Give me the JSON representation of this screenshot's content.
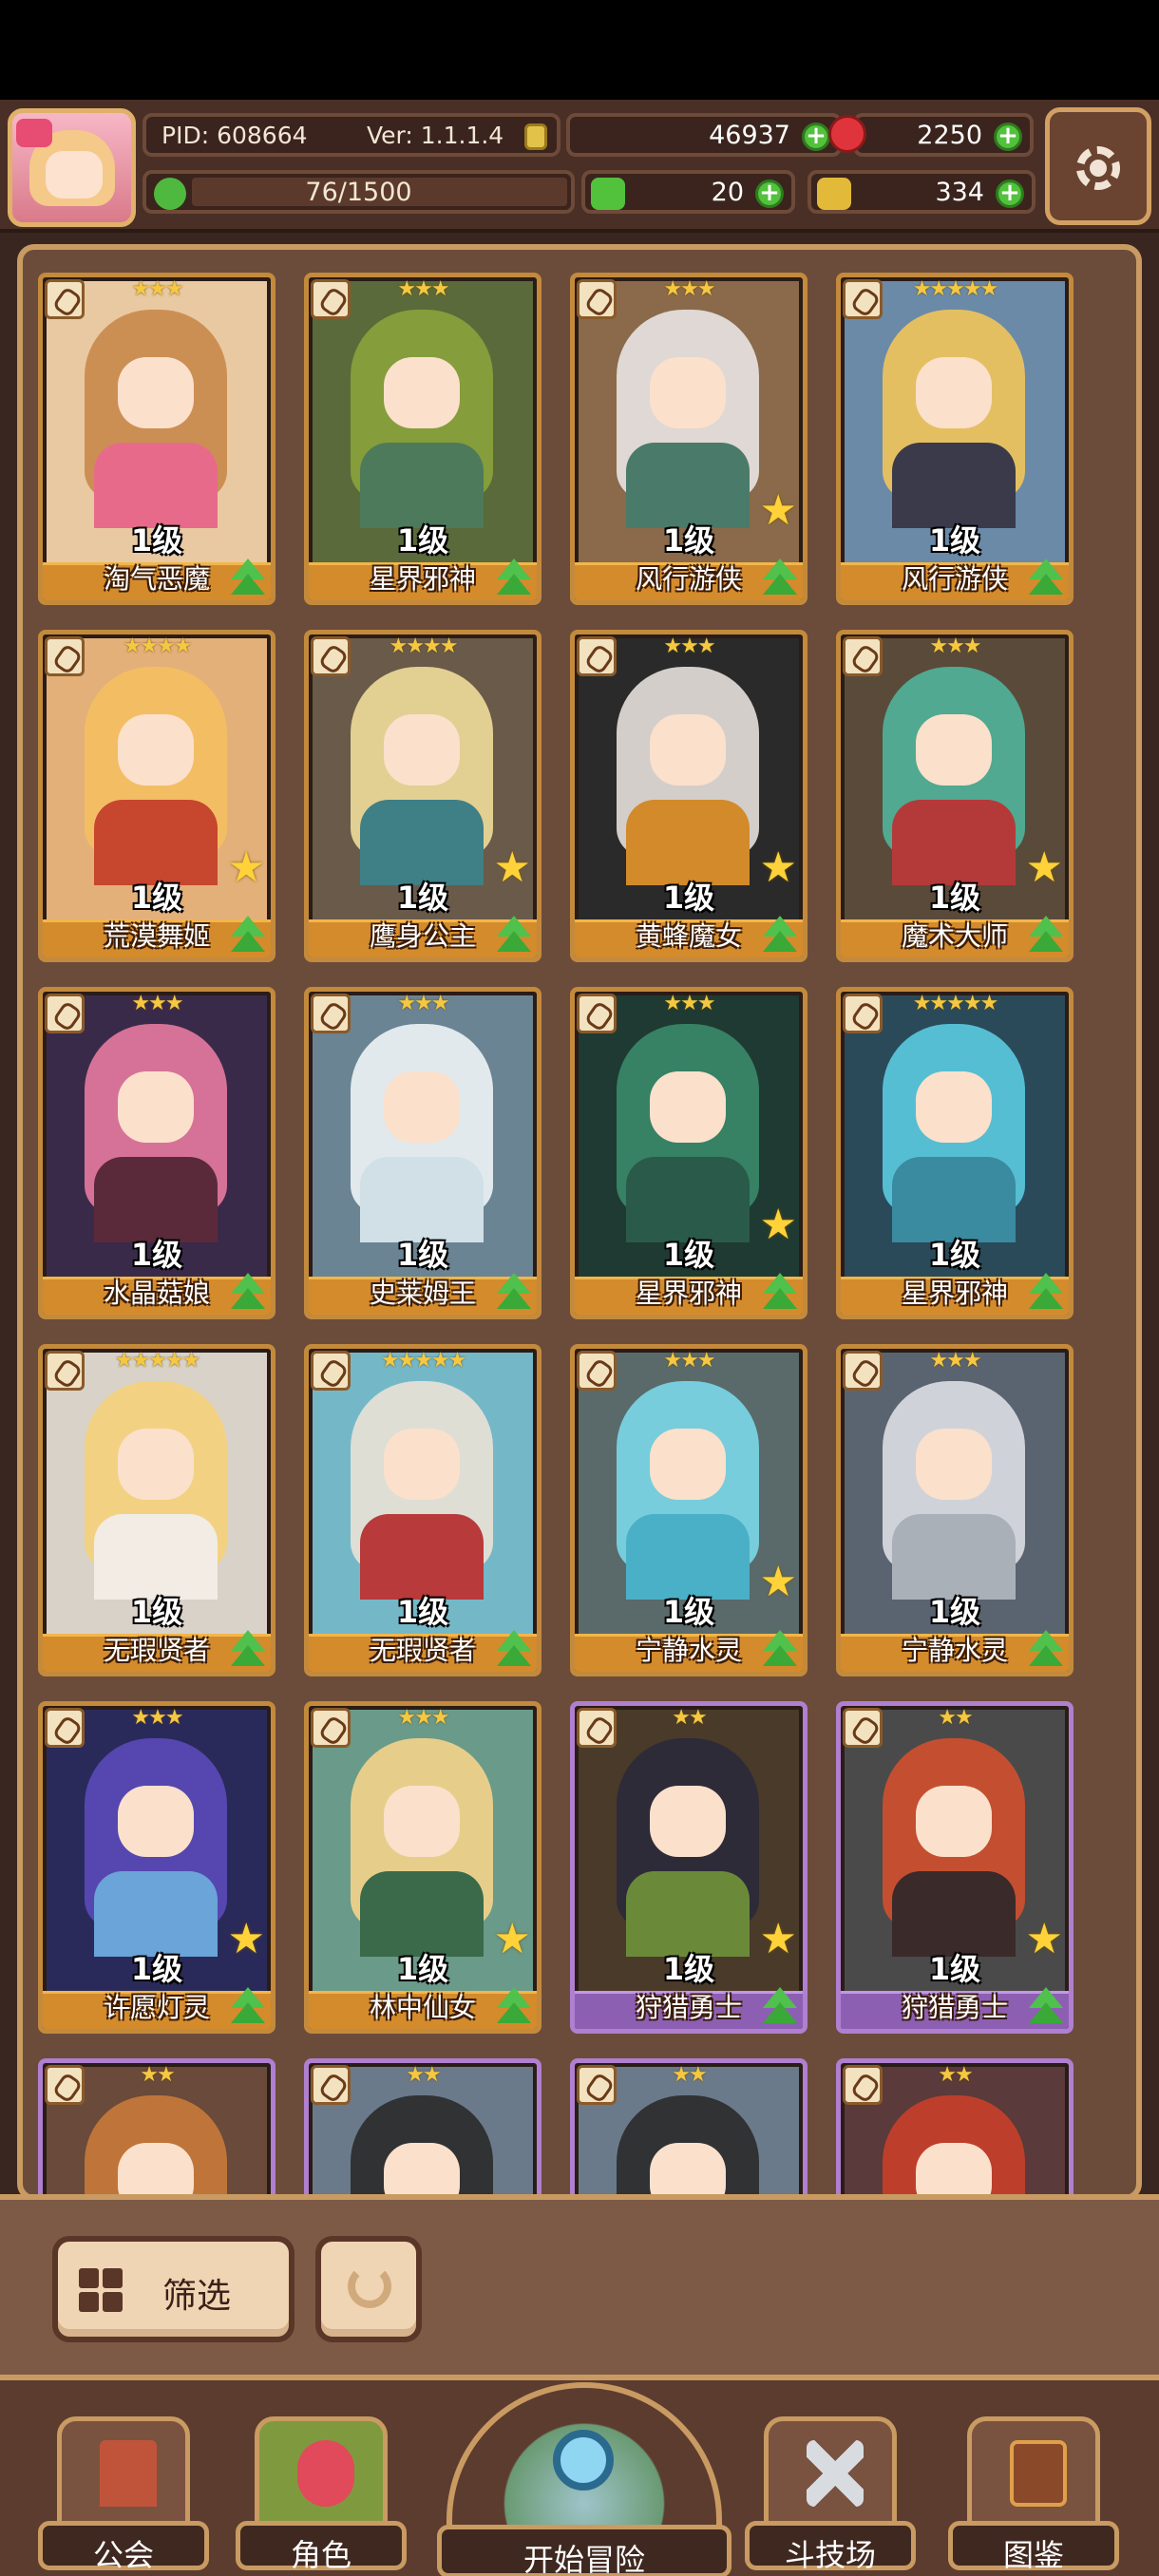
{
  "header": {
    "pid_label": "PID: 608664",
    "version_label": "Ver: 1.1.1.4",
    "gold": "46937",
    "gems": "2250",
    "energy": "76/1500",
    "clovers": "20",
    "keys": "334"
  },
  "heroes": [
    {
      "level": "1级",
      "name": "淘气恶魔",
      "stars": "★★★",
      "frame": "gold",
      "hair": "#c9884a",
      "body": "#e86a8a",
      "bg": "#e9c9a2",
      "gold_star": false
    },
    {
      "level": "1级",
      "name": "星界邪神",
      "stars": "★★★",
      "frame": "gold",
      "hair": "#8aa33c",
      "body": "#4d7a5a",
      "bg": "#5a6a3a",
      "gold_star": false
    },
    {
      "level": "1级",
      "name": "风行游侠",
      "stars": "★★★",
      "frame": "gold",
      "hair": "#e8e4e4",
      "body": "#4a7a6a",
      "bg": "#8a6a4a",
      "gold_star": true
    },
    {
      "level": "1级",
      "name": "风行游侠",
      "stars": "★★★★★",
      "frame": "gold",
      "hair": "#f2c45a",
      "body": "#3a3a4a",
      "bg": "#6a8aa8",
      "gold_star": false
    },
    {
      "level": "1级",
      "name": "荒漠舞姬",
      "stars": "★★★★",
      "frame": "gold",
      "hair": "#f4c060",
      "body": "#c7462e",
      "bg": "#e4b07a",
      "gold_star": true
    },
    {
      "level": "1级",
      "name": "鹰身公主",
      "stars": "★★★★",
      "frame": "gold",
      "hair": "#f0dc9a",
      "body": "#3f7f86",
      "bg": "#6a5a4a",
      "gold_star": true
    },
    {
      "level": "1级",
      "name": "黄蜂魔女",
      "stars": "★★★",
      "frame": "gold",
      "hair": "#e6e0dc",
      "body": "#d28a2a",
      "bg": "#2a2a2a",
      "gold_star": true
    },
    {
      "level": "1级",
      "name": "魔术大师",
      "stars": "★★★",
      "frame": "gold",
      "hair": "#4fb49a",
      "body": "#b43a3a",
      "bg": "#5a4a3a",
      "gold_star": true
    },
    {
      "level": "1级",
      "name": "水晶菇娘",
      "stars": "★★★",
      "frame": "gold",
      "hair": "#e87aa0",
      "body": "#5a2a3a",
      "bg": "#3a2a4a",
      "gold_star": false
    },
    {
      "level": "1级",
      "name": "史莱姆王",
      "stars": "★★★",
      "frame": "gold",
      "hair": "#eef4f6",
      "body": "#d0e0e6",
      "bg": "#6a8494",
      "gold_star": false
    },
    {
      "level": "1级",
      "name": "星界邪神",
      "stars": "★★★",
      "frame": "gold",
      "hair": "#3a8a6a",
      "body": "#2a5a4a",
      "bg": "#1f3a32",
      "gold_star": true
    },
    {
      "level": "1级",
      "name": "星界邪神",
      "stars": "★★★★★",
      "frame": "gold",
      "hair": "#5acbe0",
      "body": "#3a8aa0",
      "bg": "#2a4a5a",
      "gold_star": false
    },
    {
      "level": "1级",
      "name": "无瑕贤者",
      "stars": "★★★★★",
      "frame": "gold",
      "hair": "#f4d27a",
      "body": "#f2ece4",
      "bg": "#d9d2c8",
      "gold_star": false
    },
    {
      "level": "1级",
      "name": "无瑕贤者",
      "stars": "★★★★★",
      "frame": "gold",
      "hair": "#eae2d6",
      "body": "#b83a3a",
      "bg": "#74b8c8",
      "gold_star": false
    },
    {
      "level": "1级",
      "name": "宁静水灵",
      "stars": "★★★",
      "frame": "gold",
      "hair": "#7ad8e8",
      "body": "#4ab0c8",
      "bg": "#5a6a6a",
      "gold_star": true
    },
    {
      "level": "1级",
      "name": "宁静水灵",
      "stars": "★★★",
      "frame": "gold",
      "hair": "#dcdfe4",
      "body": "#aab0b8",
      "bg": "#5a6470",
      "gold_star": false
    },
    {
      "level": "1级",
      "name": "许愿灯灵",
      "stars": "★★★",
      "frame": "gold",
      "hair": "#5a4ab8",
      "body": "#6aa4d8",
      "bg": "#2a2a5a",
      "gold_star": true
    },
    {
      "level": "1级",
      "name": "林中仙女",
      "stars": "★★★",
      "frame": "gold",
      "hair": "#f4d48a",
      "body": "#3a6a4a",
      "bg": "#6a9a8a",
      "gold_star": true
    },
    {
      "level": "1级",
      "name": "狩猎勇士",
      "stars": "★★",
      "frame": "purple",
      "hair": "#2a2a3a",
      "body": "#6a8a3a",
      "bg": "#4a3a2a",
      "gold_star": true
    },
    {
      "level": "1级",
      "name": "狩猎勇士",
      "stars": "★★",
      "frame": "purple",
      "hair": "#d0502e",
      "body": "#3a2a2a",
      "bg": "#4a4a4a",
      "gold_star": true
    },
    {
      "level": "",
      "name": "",
      "stars": "★★",
      "frame": "purple",
      "hair": "#c97a3a",
      "body": "#c97a3a",
      "bg": "#6a4a3a",
      "gold_star": false
    },
    {
      "level": "",
      "name": "",
      "stars": "★★",
      "frame": "purple",
      "hair": "#2a2a2a",
      "body": "#e8e4e0",
      "bg": "#6a7a8a",
      "gold_star": false
    },
    {
      "level": "",
      "name": "",
      "stars": "★★",
      "frame": "purple",
      "hair": "#2a2a2a",
      "body": "#e8e4e0",
      "bg": "#6a7a8a",
      "gold_star": false
    },
    {
      "level": "",
      "name": "",
      "stars": "★★",
      "frame": "purple",
      "hair": "#c8402a",
      "body": "#c8402a",
      "bg": "#5a3a3a",
      "gold_star": false
    }
  ],
  "filter": {
    "filter_label": "筛选"
  },
  "nav": {
    "guild": "公会",
    "character": "角色",
    "adventure": "开始冒险",
    "arena": "斗技场",
    "codex": "图鉴"
  }
}
